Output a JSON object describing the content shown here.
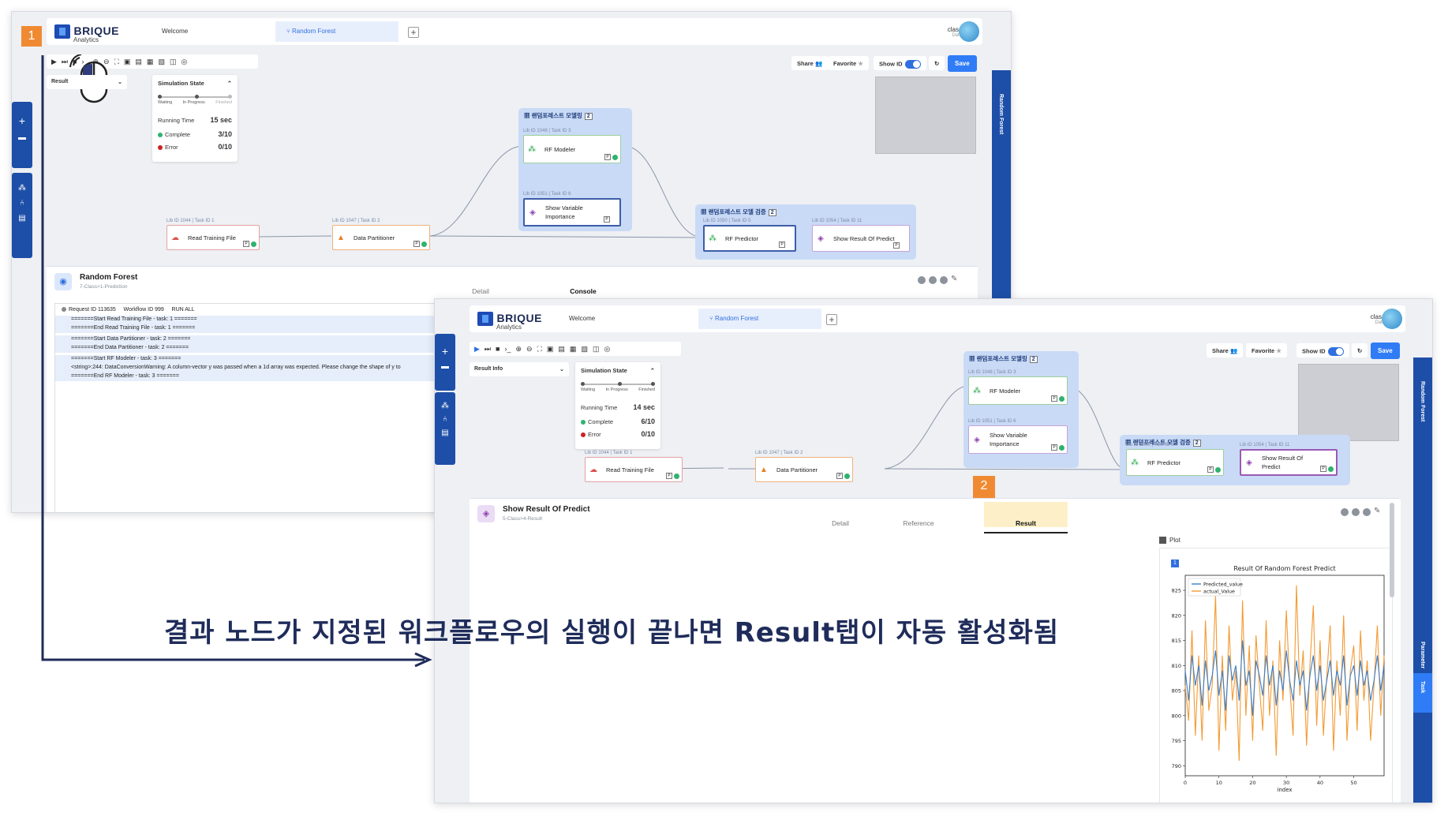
{
  "brand": {
    "name": "BRIQUE",
    "sub": "Analytics"
  },
  "tabs": {
    "welcome": "Welcome",
    "random_forest": "Random Forest",
    "add": "+"
  },
  "user": {
    "name": "class",
    "role": "Data"
  },
  "toolbar": {
    "share": "Share",
    "favorite": "Favorite",
    "show_id": "Show ID",
    "save": "Save"
  },
  "right_panel": {
    "label": "Random Forest",
    "parameter": "Parameter",
    "task": "Task"
  },
  "result_info": "Result Info",
  "result_short": "Result",
  "sim": {
    "title": "Simulation State",
    "stages": [
      "Waiting",
      "In Progress",
      "Finished"
    ],
    "running_label": "Running Time",
    "complete_label": "Complete",
    "error_label": "Error",
    "s1": {
      "running": "15 sec",
      "complete": "3/10",
      "error": "0/10"
    },
    "s2": {
      "running": "14 sec",
      "complete": "6/10",
      "error": "0/10"
    }
  },
  "groups": {
    "modeling": "랜덤포레스트 모델링",
    "modeling_count": "2",
    "validation": "랜덤포레스트 모델 검증",
    "validation_count": "2"
  },
  "nodes": {
    "read": {
      "meta": "Lib ID 1044 | Task ID 1",
      "label": "Read Training File"
    },
    "partition": {
      "meta": "Lib ID 1047 | Task ID 2",
      "label": "Data Partitioner"
    },
    "modeler": {
      "meta": "Lib ID 1048 | Task ID 3",
      "label": "RF Modeler"
    },
    "importance": {
      "meta": "Lib ID 1051 | Task ID 6",
      "label": "Show Variable Importance"
    },
    "predictor": {
      "meta": "Lib ID 1050 | Task ID 5",
      "label": "RF Predictor"
    },
    "result": {
      "meta": "Lib ID 1054 | Task ID 11",
      "label": "Show Result Of Predict"
    }
  },
  "panel1": {
    "title": "Random Forest",
    "sub": "7-Class>1-Prediction",
    "tabs": [
      "Detail",
      "Console"
    ],
    "request": {
      "id": "Request ID 113635",
      "workflow": "Workflow ID 999",
      "mode": "RUN ALL"
    },
    "lines": [
      "=======Start Read Training File - task: 1 =======",
      "=======End Read Training File - task: 1 =======",
      "=======Start Data Partitioner - task: 2 =======",
      "=======End Data Partitioner - task: 2 =======",
      "=======Start RF Modeler - task: 3 =======",
      "<string>:244: DataConversionWarning: A column-vector y was passed when a 1d array was expected. Please change the shape of y to",
      "=======End RF Modeler - task: 3 ======="
    ]
  },
  "panel2": {
    "title": "Show Result Of Predict",
    "sub": "5-Class>4-Result",
    "tabs": [
      "Detail",
      "Reference",
      "Result"
    ],
    "plot_label": "Plot",
    "plot_index": "1"
  },
  "badges": {
    "one": "1",
    "two": "2"
  },
  "caption": "결과 노드가 지정된 워크플로우의 실행이 끝나면 Result탭이 자동 활성화됨",
  "colors": {
    "blue_series": "#3b7ec8",
    "orange_series": "#f39a34",
    "accent": "#2f7cf6",
    "badge": "#f08a32"
  },
  "chart_data": {
    "type": "line",
    "title": "Result Of Random Forest Predict",
    "xlabel": "index",
    "ylabel": "",
    "xlim": [
      0,
      59
    ],
    "ylim": [
      788,
      828
    ],
    "xticks": [
      0,
      10,
      20,
      30,
      40,
      50
    ],
    "yticks": [
      790,
      795,
      800,
      805,
      810,
      815,
      820,
      825
    ],
    "legend": "top-left",
    "series": [
      {
        "name": "Predicted_value",
        "color": "#3b7ec8",
        "values": [
          809,
          803,
          812,
          806,
          810,
          802,
          811,
          805,
          808,
          813,
          804,
          809,
          801,
          812,
          807,
          810,
          803,
          815,
          806,
          809,
          800,
          811,
          808,
          804,
          812,
          806,
          810,
          802,
          809,
          805,
          813,
          807,
          803,
          811,
          806,
          809,
          801,
          808,
          812,
          805,
          810,
          803,
          807,
          811,
          804,
          809,
          806,
          812,
          802,
          808,
          810,
          804,
          811,
          806,
          809,
          803,
          807,
          812,
          805,
          810
        ]
      },
      {
        "name": "actual_Value",
        "color": "#f39a34",
        "values": [
          806,
          799,
          817,
          796,
          812,
          795,
          819,
          801,
          806,
          824,
          793,
          812,
          797,
          818,
          803,
          809,
          791,
          823,
          800,
          814,
          795,
          816,
          806,
          797,
          819,
          800,
          811,
          792,
          815,
          803,
          821,
          806,
          796,
          826,
          804,
          813,
          794,
          810,
          822,
          798,
          815,
          796,
          808,
          818,
          793,
          811,
          800,
          820,
          795,
          809,
          814,
          797,
          817,
          803,
          811,
          795,
          806,
          818,
          800,
          812
        ]
      }
    ]
  }
}
